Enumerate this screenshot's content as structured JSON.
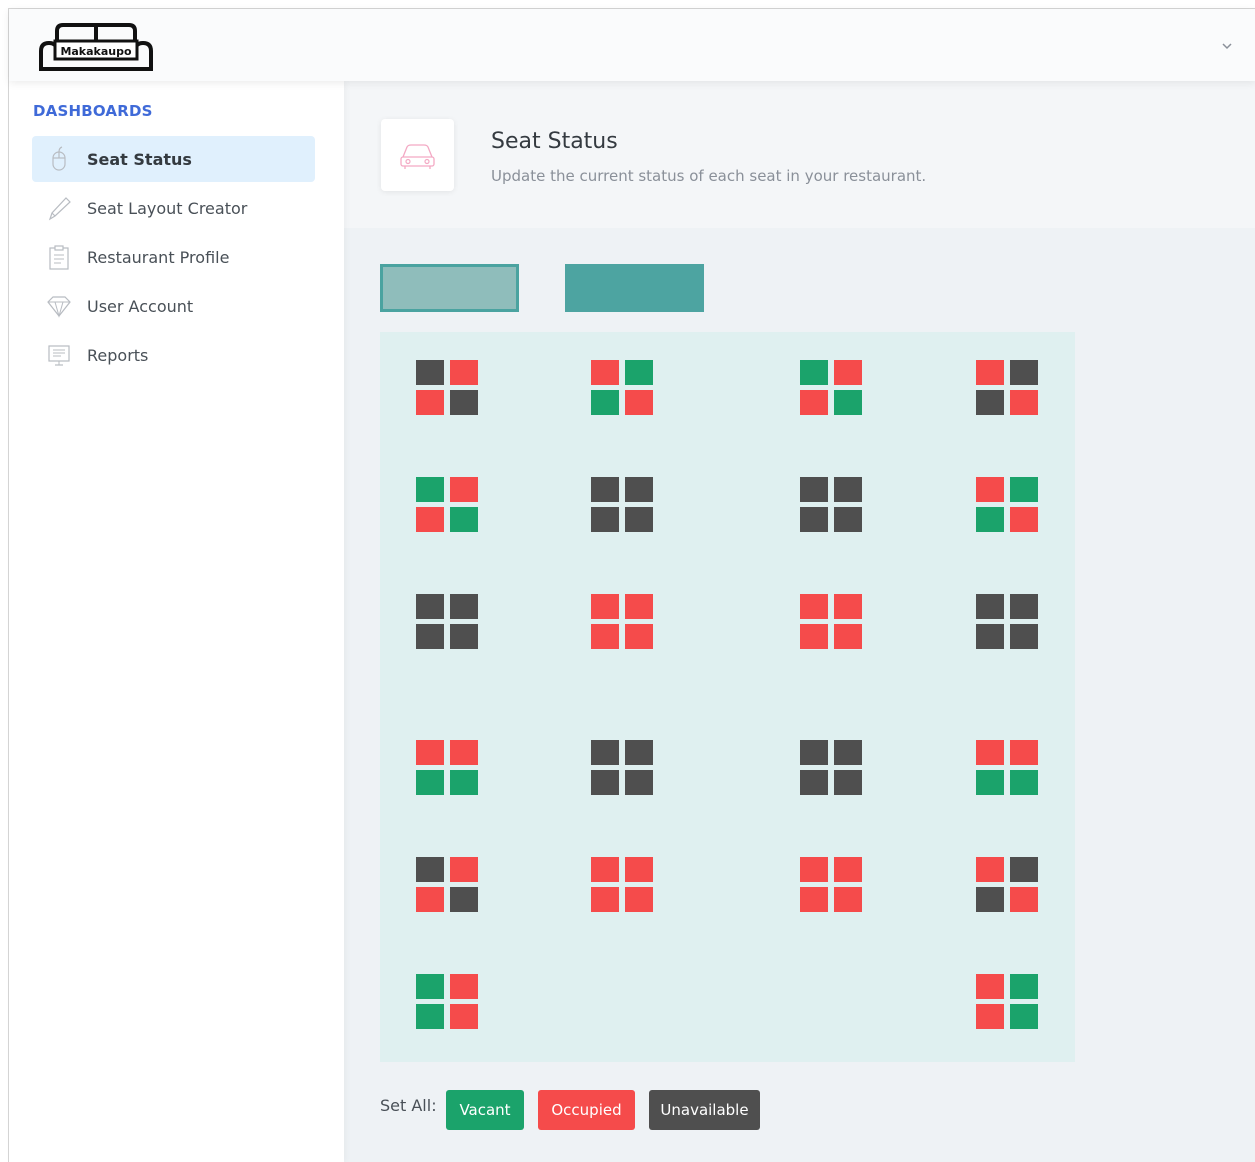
{
  "app": {
    "brand": "Makakaupo"
  },
  "sidebar": {
    "heading": "DASHBOARDS",
    "items": [
      {
        "label": "Seat Status",
        "icon": "mouse-icon",
        "active": true
      },
      {
        "label": "Seat Layout Creator",
        "icon": "pencil-icon",
        "active": false
      },
      {
        "label": "Restaurant Profile",
        "icon": "clipboard-icon",
        "active": false
      },
      {
        "label": "User Account",
        "icon": "diamond-icon",
        "active": false
      },
      {
        "label": "Reports",
        "icon": "monitor-icon",
        "active": false
      }
    ]
  },
  "page": {
    "title": "Seat Status",
    "subtitle": "Update the current status of each seat in your restaurant.",
    "icon": "car-icon"
  },
  "floor_tabs": [
    "",
    ""
  ],
  "colors": {
    "vacant": "#1ba36b",
    "occupied": "#f54b4b",
    "unavailable": "#4f4f4f",
    "accent": "#3f6ad8"
  },
  "seat_tables": [
    {
      "row": 1,
      "col": 1,
      "seats": [
        "u",
        "o",
        "o",
        "u"
      ]
    },
    {
      "row": 1,
      "col": 2,
      "seats": [
        "o",
        "v",
        "v",
        "o"
      ]
    },
    {
      "row": 1,
      "col": 3,
      "seats": [
        "v",
        "o",
        "o",
        "v"
      ]
    },
    {
      "row": 1,
      "col": 4,
      "seats": [
        "o",
        "u",
        "u",
        "o"
      ]
    },
    {
      "row": 2,
      "col": 1,
      "seats": [
        "v",
        "o",
        "o",
        "v"
      ]
    },
    {
      "row": 2,
      "col": 2,
      "seats": [
        "u",
        "u",
        "u",
        "u"
      ]
    },
    {
      "row": 2,
      "col": 3,
      "seats": [
        "u",
        "u",
        "u",
        "u"
      ]
    },
    {
      "row": 2,
      "col": 4,
      "seats": [
        "o",
        "v",
        "v",
        "o"
      ]
    },
    {
      "row": 3,
      "col": 1,
      "seats": [
        "u",
        "u",
        "u",
        "u"
      ]
    },
    {
      "row": 3,
      "col": 2,
      "seats": [
        "o",
        "o",
        "o",
        "o"
      ]
    },
    {
      "row": 3,
      "col": 3,
      "seats": [
        "o",
        "o",
        "o",
        "o"
      ]
    },
    {
      "row": 3,
      "col": 4,
      "seats": [
        "u",
        "u",
        "u",
        "u"
      ]
    },
    {
      "row": 4,
      "col": 1,
      "seats": [
        "o",
        "o",
        "v",
        "v"
      ]
    },
    {
      "row": 4,
      "col": 2,
      "seats": [
        "u",
        "u",
        "u",
        "u"
      ]
    },
    {
      "row": 4,
      "col": 3,
      "seats": [
        "u",
        "u",
        "u",
        "u"
      ]
    },
    {
      "row": 4,
      "col": 4,
      "seats": [
        "o",
        "o",
        "v",
        "v"
      ]
    },
    {
      "row": 5,
      "col": 1,
      "seats": [
        "u",
        "o",
        "o",
        "u"
      ]
    },
    {
      "row": 5,
      "col": 2,
      "seats": [
        "o",
        "o",
        "o",
        "o"
      ]
    },
    {
      "row": 5,
      "col": 3,
      "seats": [
        "o",
        "o",
        "o",
        "o"
      ]
    },
    {
      "row": 5,
      "col": 4,
      "seats": [
        "o",
        "u",
        "u",
        "o"
      ]
    },
    {
      "row": 6,
      "col": 1,
      "seats": [
        "v",
        "o",
        "v",
        "o"
      ]
    },
    {
      "row": 6,
      "col": 4,
      "seats": [
        "o",
        "v",
        "o",
        "v"
      ]
    }
  ],
  "set_all": {
    "label": "Set All:",
    "vacant": "Vacant",
    "occupied": "Occupied",
    "unavailable": "Unavailable"
  }
}
